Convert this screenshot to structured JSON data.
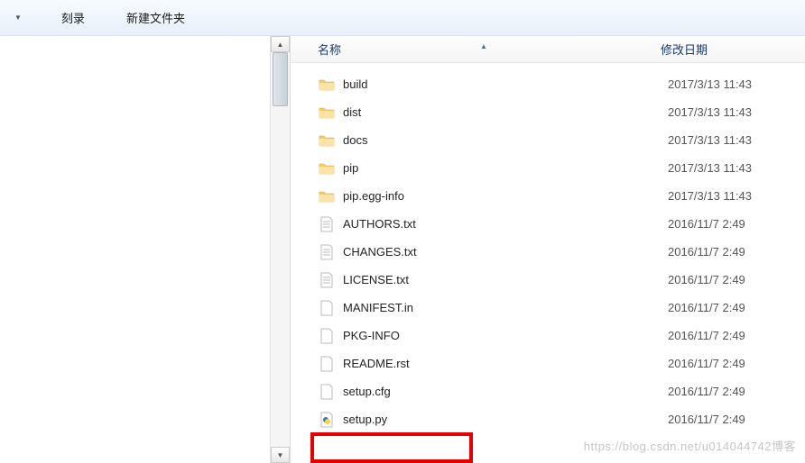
{
  "toolbar": {
    "burn": "刻录",
    "new_folder": "新建文件夹"
  },
  "columns": {
    "name": "名称",
    "modified": "修改日期"
  },
  "files": [
    {
      "icon": "folder",
      "name": "build",
      "date": "2017/3/13 11:43"
    },
    {
      "icon": "folder",
      "name": "dist",
      "date": "2017/3/13 11:43"
    },
    {
      "icon": "folder",
      "name": "docs",
      "date": "2017/3/13 11:43"
    },
    {
      "icon": "folder",
      "name": "pip",
      "date": "2017/3/13 11:43"
    },
    {
      "icon": "folder",
      "name": "pip.egg-info",
      "date": "2017/3/13 11:43"
    },
    {
      "icon": "text",
      "name": "AUTHORS.txt",
      "date": "2016/11/7 2:49"
    },
    {
      "icon": "text",
      "name": "CHANGES.txt",
      "date": "2016/11/7 2:49"
    },
    {
      "icon": "text",
      "name": "LICENSE.txt",
      "date": "2016/11/7 2:49"
    },
    {
      "icon": "file",
      "name": "MANIFEST.in",
      "date": "2016/11/7 2:49"
    },
    {
      "icon": "file",
      "name": "PKG-INFO",
      "date": "2016/11/7 2:49"
    },
    {
      "icon": "file",
      "name": "README.rst",
      "date": "2016/11/7 2:49"
    },
    {
      "icon": "file",
      "name": "setup.cfg",
      "date": "2016/11/7 2:49"
    },
    {
      "icon": "python",
      "name": "setup.py",
      "date": "2016/11/7 2:49"
    }
  ],
  "watermark": "https://blog.csdn.net/u014044742博客"
}
